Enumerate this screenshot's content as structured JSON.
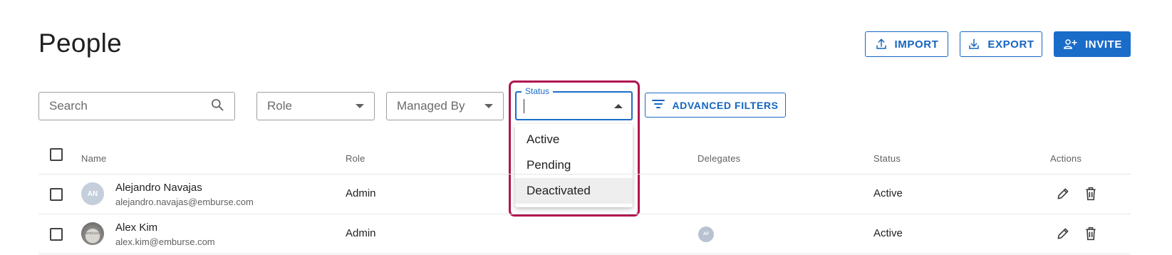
{
  "header": {
    "title": "People",
    "import_label": "IMPORT",
    "export_label": "EXPORT",
    "invite_label": "INVITE"
  },
  "filters": {
    "search_placeholder": "Search",
    "role_placeholder": "Role",
    "managed_by_placeholder": "Managed By",
    "status_label": "Status",
    "status_value": "",
    "status_options": [
      "Active",
      "Pending",
      "Deactivated"
    ],
    "status_hovered_option": "Deactivated",
    "advanced_filters_label": "ADVANCED FILTERS"
  },
  "table": {
    "columns": {
      "name": "Name",
      "role": "Role",
      "delegates": "Delegates",
      "status": "Status",
      "actions": "Actions"
    },
    "rows": [
      {
        "avatar_initials": "AN",
        "name": "Alejandro Navajas",
        "email": "alejandro.navajas@emburse.com",
        "role": "Admin",
        "delegates": [],
        "status": "Active"
      },
      {
        "avatar_text": "emburse",
        "name": "Alex Kim",
        "email": "alex.kim@emburse.com",
        "role": "Admin",
        "delegates": [
          "AF"
        ],
        "status": "Active"
      }
    ]
  },
  "colors": {
    "primary": "#1a6cc9",
    "highlight": "#b0164f"
  },
  "icons": {
    "import": "upload-icon",
    "export": "download-icon",
    "invite": "person-add-icon",
    "search": "search-icon",
    "filter": "filter-list-icon",
    "edit": "pencil-icon",
    "delete": "trash-icon"
  }
}
